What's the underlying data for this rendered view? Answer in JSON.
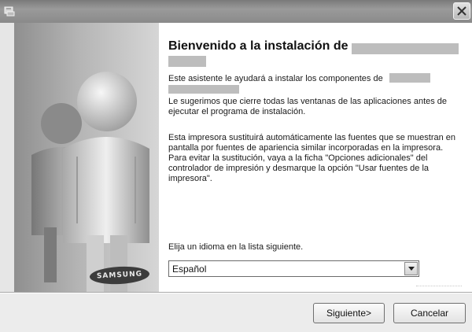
{
  "window": {
    "title": "",
    "icons": {
      "app": "installer-icon",
      "close": "close-icon"
    }
  },
  "side_panel": {
    "brand_logo_text": "SAMSUNG",
    "illustration": "people-figures"
  },
  "main": {
    "title": "Bienvenido a la instalación de",
    "intro": "Este asistente le ayudará a instalar los componentes de",
    "close_apps_text": "Le sugerimos que cierre todas las ventanas de las aplicaciones antes de ejecutar el programa de instalación.",
    "font_replacement_text": "Esta impresora sustituirá automáticamente las fuentes que se muestran en pantalla por fuentes de apariencia similar incorporadas en la impresora. Para evitar la sustitución, vaya a la ficha \"Opciones adicionales\" del controlador de impresión y desmarque la opción \"Usar fuentes de la impresora\".",
    "language_label": "Elija un idioma en la lista siguiente.",
    "language_selected": "Español"
  },
  "buttons": {
    "next_label": "Siguiente>",
    "cancel_label": "Cancelar"
  },
  "colors": {
    "title_bar": "#8a8a8a",
    "panel_background": "#ececec",
    "content_background": "#ffffff",
    "redaction": "#bdbdbd"
  }
}
